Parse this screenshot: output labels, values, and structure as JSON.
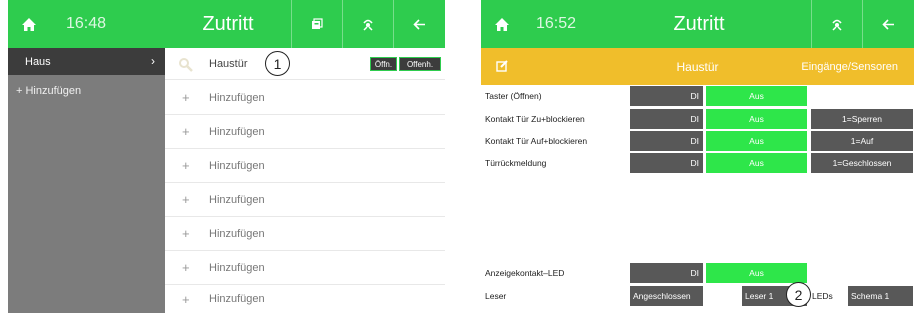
{
  "left_screen": {
    "header": {
      "time": "16:48",
      "title": "Zutritt",
      "icons": [
        "home-icon",
        "cards-icon",
        "zones-icon",
        "back-arrow-icon"
      ]
    },
    "sidebar": {
      "active_item": "Haus",
      "add_item": "+ Hinzufügen"
    },
    "list": {
      "first_item": {
        "label": "Haustür",
        "open_button": "Öffn.",
        "opened_button": "Offenh.",
        "callout": "1"
      },
      "add_label": "Hinzufügen"
    }
  },
  "right_screen": {
    "header": {
      "time": "16:52",
      "title": "Zutritt",
      "icons": [
        "home-icon",
        "zones-icon",
        "back-arrow-icon"
      ]
    },
    "subbar": {
      "title": "Haustür",
      "link": "Eingänge/Sensoren",
      "icon": "edit-icon"
    },
    "rows": [
      {
        "label": "Taster (Öffnen)",
        "type": "DI",
        "state": "Aus",
        "extra": ""
      },
      {
        "label": "Kontakt Tür Zu+blockieren",
        "type": "DI",
        "state": "Aus",
        "extra": "1=Sperren"
      },
      {
        "label": "Kontakt Tür Auf+blockieren",
        "type": "DI",
        "state": "Aus",
        "extra": "1=Auf"
      },
      {
        "label": "Türrückmeldung",
        "type": "DI",
        "state": "Aus",
        "extra": "1=Geschlossen"
      }
    ],
    "led_row": {
      "label": "Anzeigekontakt–LED",
      "type": "DI",
      "state": "Aus"
    },
    "reader_row": {
      "label": "Leser",
      "status": "Angeschlossen",
      "reader": "Leser 1",
      "callout": "2",
      "leds_label": "LEDs",
      "scheme": "Schema 1"
    }
  },
  "colors": {
    "header_green": "#2ecc4e",
    "subbar_yellow": "#f0be2b",
    "state_green": "#2ee64a",
    "cell_dark": "#585858"
  }
}
